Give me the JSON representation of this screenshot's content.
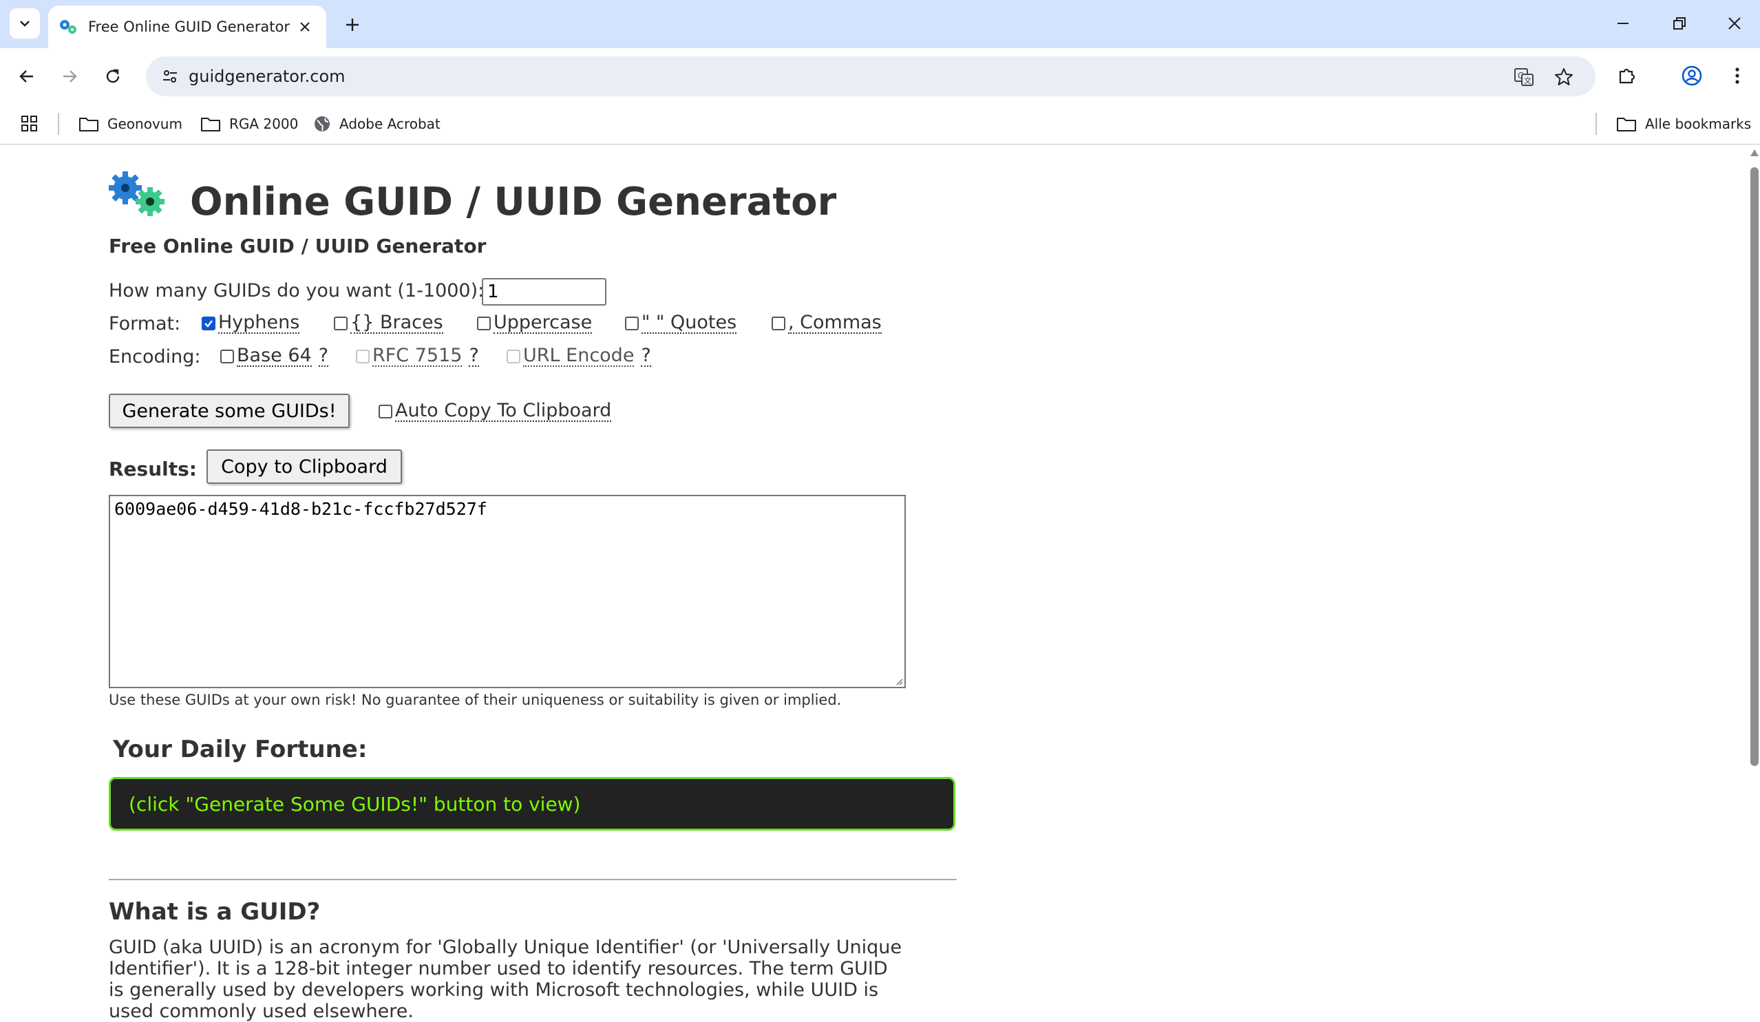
{
  "browser": {
    "tab_title": "Free Online GUID Generator",
    "url": "guidgenerator.com",
    "bookmarks": [
      {
        "label": "Geonovum",
        "icon": "folder-icon"
      },
      {
        "label": "RGA 2000",
        "icon": "folder-icon"
      },
      {
        "label": "Adobe Acrobat",
        "icon": "globe-icon"
      }
    ],
    "all_bookmarks": "Alle bookmarks"
  },
  "page": {
    "title": "Online GUID / UUID Generator",
    "subtitle": "Free Online GUID / UUID Generator",
    "count_label": "How many GUIDs do you want (1-1000):",
    "count_value": "1",
    "format_label": "Format:",
    "format_options": [
      {
        "label": "Hyphens",
        "checked": true
      },
      {
        "label": "{} Braces",
        "checked": false
      },
      {
        "label": "Uppercase",
        "checked": false
      },
      {
        "label": "\" \" Quotes",
        "checked": false
      },
      {
        "label": ", Commas",
        "checked": false
      }
    ],
    "encoding_label": "Encoding:",
    "encoding_options": [
      {
        "label": "Base 64",
        "help": "?",
        "checked": false,
        "enabled": true
      },
      {
        "label": "RFC 7515",
        "help": "?",
        "checked": false,
        "enabled": false
      },
      {
        "label": "URL Encode",
        "help": "?",
        "checked": false,
        "enabled": false
      }
    ],
    "generate_button": "Generate some GUIDs!",
    "auto_copy_label": "Auto Copy To Clipboard",
    "results_label": "Results:",
    "copy_button": "Copy to Clipboard",
    "result_value": "6009ae06-d459-41d8-b21c-fccfb27d527f",
    "disclaimer": "Use these GUIDs at your own risk! No guarantee of their uniqueness or suitability is given or implied.",
    "fortune_title": "Your Daily Fortune:",
    "fortune_text": "(click \"Generate Some GUIDs!\" button to view)",
    "what_is_title": "What is a GUID?",
    "what_is_text": "GUID (aka UUID) is an acronym for 'Globally Unique Identifier' (or 'Universally Unique Identifier'). It is a 128-bit integer number used to identify resources. The term GUID is generally used by developers working with Microsoft technologies, while UUID is used commonly used elsewhere."
  },
  "colors": {
    "tabstrip": "#d3e3fd",
    "omnibox": "#e9eef6",
    "checkbox_accent": "#0b57d0",
    "fortune_bg": "#222222",
    "fortune_border": "#66dd22",
    "fortune_text": "#7cfc00",
    "logo_blue": "#2a7fd4",
    "logo_green": "#3cc98a"
  }
}
